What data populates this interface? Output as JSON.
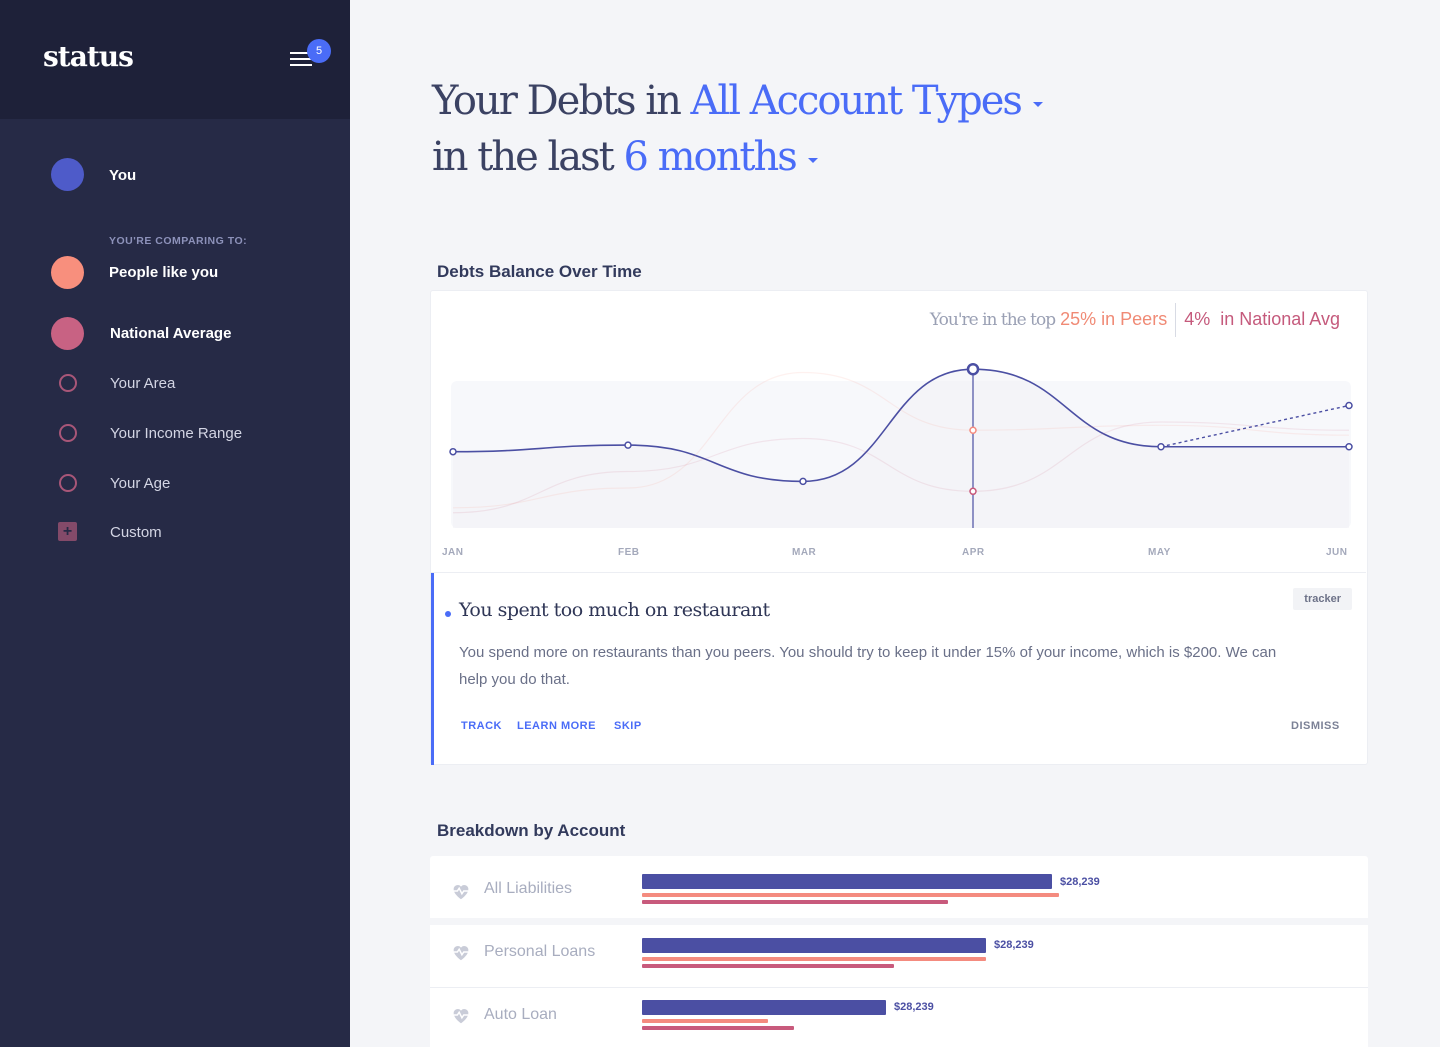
{
  "sidebar": {
    "logo": "status",
    "notification_count": "5",
    "you_label": "You",
    "comparing_caption": "YOU'RE COMPARING TO:",
    "items": [
      {
        "label": "People like you",
        "color": "#f88f7d"
      },
      {
        "label": "National Average",
        "color": "#c86283"
      },
      {
        "label": "Your Area"
      },
      {
        "label": "Your Income Range"
      },
      {
        "label": "Your Age"
      },
      {
        "label": "Custom"
      }
    ],
    "you_color": "#4e5bc9"
  },
  "header": {
    "line1_prefix": "Your Debts in",
    "account_type": "All Account Types",
    "line2_prefix": "in the last",
    "period": "6 months"
  },
  "debts_chart": {
    "title": "Debts Balance Over Time",
    "stats_prefix": "You're in the top",
    "peers_value": "25%",
    "peers_label": "in Peers",
    "national_value": "4%",
    "national_label": "in National Avg",
    "months": [
      "JAN",
      "FEB",
      "MAR",
      "APR",
      "MAY",
      "JUN"
    ]
  },
  "chart_data": {
    "type": "line",
    "x": [
      "JAN",
      "FEB",
      "MAR",
      "APR",
      "MAY",
      "JUN"
    ],
    "series": [
      {
        "name": "You",
        "values": [
          42,
          46,
          24,
          92,
          45,
          45
        ],
        "projected_last": 70,
        "color": "#4b4fa3"
      },
      {
        "name": "People like you",
        "values": [
          8,
          20,
          90,
          55,
          58,
          52
        ],
        "color": "#f48b7f"
      },
      {
        "name": "National Average",
        "values": [
          5,
          30,
          50,
          18,
          60,
          55
        ],
        "color": "#c85a7c"
      }
    ],
    "highlight": "APR",
    "grid": false
  },
  "tip": {
    "title": "You spent too much on restaurant",
    "body": "You spend more on restaurants than you peers. You should try to keep it under 15% of your income, which is $200. We can help you do that.",
    "tag": "tracker",
    "actions": {
      "track": "TRACK",
      "learn_more": "LEARN MORE",
      "skip": "SKIP",
      "dismiss": "DISMISS"
    }
  },
  "breakdown": {
    "title": "Breakdown by Account",
    "rows": [
      {
        "label": "All Liabilities",
        "value": "$28,239",
        "you": 1.0,
        "peers": 1.017,
        "national": 0.746
      },
      {
        "label": "Personal Loans",
        "value": "$28,239",
        "you": 0.839,
        "peers": 0.839,
        "national": 0.615
      },
      {
        "label": "Auto Loan",
        "value": "$28,239",
        "you": 0.595,
        "peers": 0.307,
        "national": 0.371
      }
    ]
  }
}
